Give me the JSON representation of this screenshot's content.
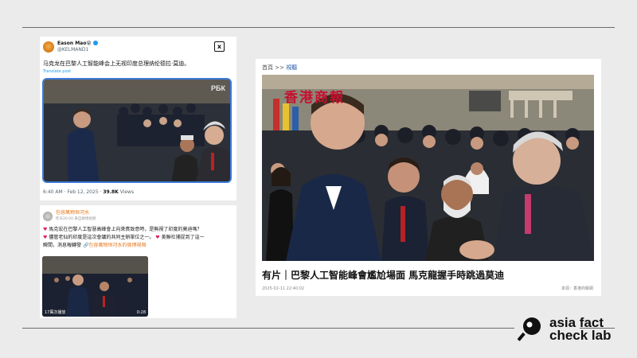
{
  "tweet": {
    "author_name": "Eason Mao",
    "author_emoji": "😵",
    "handle": "@KELMAND1",
    "text": "马克龙在巴黎人工智能峰会上无视印度总理纳伦德拉·莫迪。",
    "translate_label": "Translate post",
    "watermark": "РБК",
    "timestamp": "6:40 AM · Feb 12, 2025 · ",
    "views_count": "39.8K",
    "views_label": " Views",
    "x_logo": "x"
  },
  "weibo": {
    "author_name": "包容萬物恒河水",
    "meta": "昨天20:00 来自微博视频",
    "line1": "馬克宏在巴黎人工智慧高峰會上向來賓致意時，是無視了印度的莫迪嗎？",
    "line2": "儘管老仙的印度是這次會議的共同主辦單位之一。",
    "line2b": "美聯社捕捉到了這一",
    "line3": "瞬間，消息報轉發",
    "line3_link": "包容萬物恒河水的微博視頻",
    "video_views": "17萬次播放",
    "video_duration": "0:28"
  },
  "news": {
    "breadcrumb_home": "首頁",
    "breadcrumb_sep": ">>",
    "breadcrumb_video": "視聽",
    "watermark": "香港商報",
    "headline": "有片｜巴黎人工智能峰會尷尬場面 馬克龍握手時跳過莫迪",
    "date": "2025-02-11 22:40:02",
    "source": "來源：香港商報網"
  },
  "brand": {
    "line1": "asia fact",
    "line2": "check lab"
  },
  "colors": {
    "background": "#ebebeb",
    "link_blue": "#1d9bf0",
    "verified_blue": "#1d9bf0",
    "weibo_orange": "#e8791e",
    "news_red": "#c8102e"
  }
}
